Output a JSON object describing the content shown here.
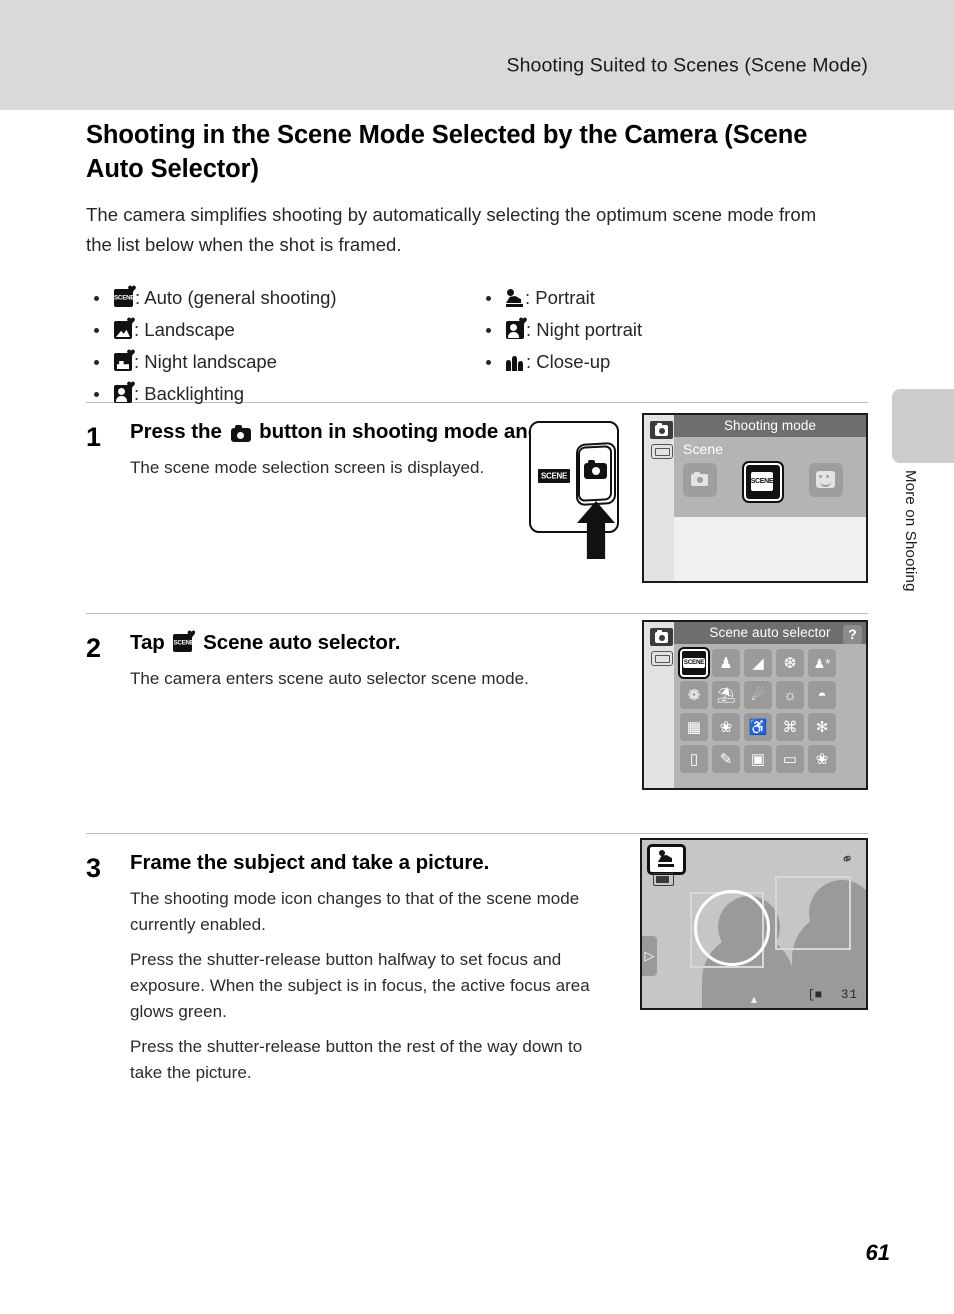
{
  "header": {
    "running_title": "Shooting Suited to Scenes (Scene Mode)"
  },
  "thumb_tab": {
    "label": "More on Shooting"
  },
  "page": {
    "number": "61",
    "title": "Shooting in the Scene Mode Selected by the Camera (Scene Auto Selector)",
    "intro": "The camera simplifies shooting by automatically selecting the optimum scene mode from the list below when the shot is framed."
  },
  "scene_list": {
    "column1": [
      {
        "icon": "scene-auto-icon",
        "text": ": Auto (general shooting)"
      },
      {
        "icon": "landscape-icon",
        "text": ": Landscape"
      },
      {
        "icon": "night-landscape-icon",
        "text": ": Night landscape"
      },
      {
        "icon": "backlighting-icon",
        "text": ": Backlighting"
      }
    ],
    "column2": [
      {
        "icon": "portrait-icon",
        "text": ": Portrait"
      },
      {
        "icon": "night-portrait-icon",
        "text": ": Night portrait"
      },
      {
        "icon": "close-up-icon",
        "text": ": Close-up"
      }
    ]
  },
  "steps": [
    {
      "number": "1",
      "heading_before": "Press the",
      "heading_mid": "button in shooting mode and tap",
      "heading_after": ".",
      "body": [
        "The scene mode selection screen is displayed."
      ]
    },
    {
      "number": "2",
      "heading_before": "Tap",
      "heading_mid": "Scene auto selector.",
      "heading_after": "",
      "body": [
        "The camera enters scene auto selector scene mode."
      ]
    },
    {
      "number": "3",
      "heading_before": "Frame the subject and take a picture.",
      "heading_mid": "",
      "heading_after": "",
      "body": [
        "The shooting mode icon changes to that of the scene mode currently enabled.",
        "Press the shutter-release button halfway to set focus and exposure. When the subject is in focus, the active focus area glows green.",
        "Press the shutter-release button the rest of the way down to take the picture."
      ]
    }
  ],
  "figure_step1": {
    "scene_tag": "SCENE",
    "camera_button": "camera-button-icon",
    "arrow": "up-arrow-icon"
  },
  "screen_shooting_mode": {
    "title": "Shooting mode",
    "subtitle": "Scene",
    "mode_cells": [
      {
        "name": "auto-mode-cell",
        "selected": false
      },
      {
        "name": "scene-mode-cell",
        "label": "SCENE",
        "selected": true
      },
      {
        "name": "smart-portrait-mode-cell",
        "selected": false
      }
    ],
    "side_icons": [
      "camera-tab-icon",
      "playback-tab-icon"
    ]
  },
  "screen_scene_selector": {
    "title": "Scene auto selector",
    "help_label": "?",
    "side_icons": [
      "camera-tab-icon",
      "playback-tab-icon"
    ],
    "cells": [
      {
        "name": "scene-auto-selector-cell",
        "glyph": "SCENE",
        "selected": true
      },
      {
        "name": "portrait-cell",
        "glyph": "♟"
      },
      {
        "name": "landscape-cell",
        "glyph": "◢"
      },
      {
        "name": "sports-cell",
        "glyph": "❆"
      },
      {
        "name": "night-portrait-cell",
        "glyph": "♟*"
      },
      {
        "name": "party-indoor-cell",
        "glyph": "❁"
      },
      {
        "name": "beach-cell",
        "glyph": "⛱"
      },
      {
        "name": "snow-cell",
        "glyph": "❄"
      },
      {
        "name": "sunset-cell",
        "glyph": "☀"
      },
      {
        "name": "dusk-dawn-cell",
        "glyph": "◓"
      },
      {
        "name": "night-landscape-cell",
        "glyph": "▦"
      },
      {
        "name": "close-up-cell",
        "glyph": "❀"
      },
      {
        "name": "food-cell",
        "glyph": "ἷ4"
      },
      {
        "name": "museum-cell",
        "glyph": "ἽB"
      },
      {
        "name": "fireworks-cell",
        "glyph": "✻"
      },
      {
        "name": "black-white-copy-cell",
        "glyph": "▯"
      },
      {
        "name": "draw-cell",
        "glyph": "✎"
      },
      {
        "name": "backlighting-cell",
        "glyph": "▣"
      },
      {
        "name": "panorama-cell",
        "glyph": "▭"
      },
      {
        "name": "pet-portrait-cell",
        "glyph": "ὀ8"
      }
    ]
  },
  "screen_live_view": {
    "mode_badge": "portrait-mode-icon",
    "battery": "battery-icon",
    "shake_warning": "camera-shake-icon",
    "image_size": "[■",
    "shots_remaining": "31",
    "left_tab": "▷",
    "bottom_tab": "▲"
  }
}
